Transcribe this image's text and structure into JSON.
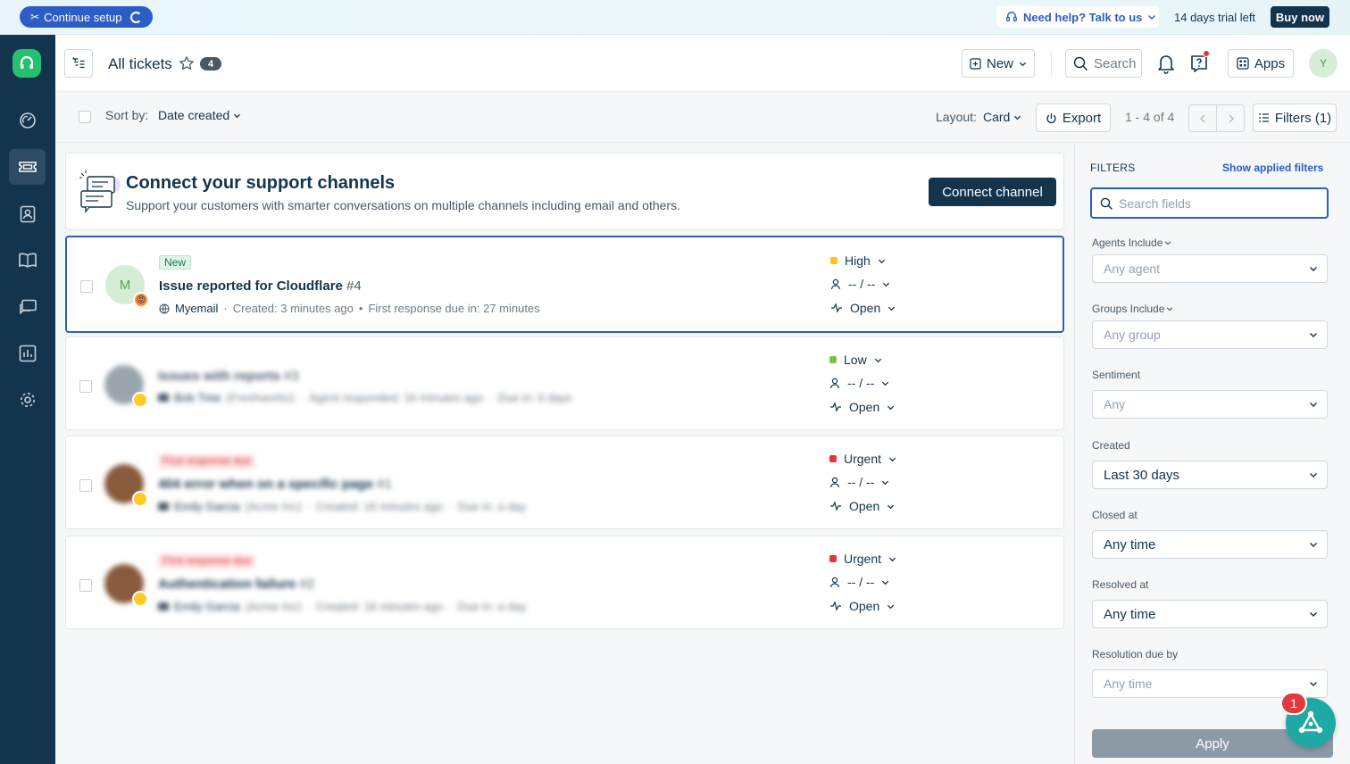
{
  "banner": {
    "continue_setup": "Continue setup",
    "help": "Need help? Talk to us",
    "trial": "14 days trial left",
    "buy_now": "Buy now"
  },
  "header": {
    "title": "All tickets",
    "count": "4",
    "new_label": "New",
    "search_placeholder": "Search",
    "apps_label": "Apps",
    "avatar_initial": "Y"
  },
  "toolbar": {
    "sort_by_label": "Sort by:",
    "sort_value": "Date created",
    "layout_label": "Layout:",
    "layout_value": "Card",
    "export_label": "Export",
    "pagination": "1 - 4 of 4",
    "filters_label": "Filters (1)"
  },
  "channel_card": {
    "title": "Connect your support channels",
    "subtitle": "Support your customers with smarter conversations on multiple channels including email and others.",
    "button": "Connect channel"
  },
  "tickets": [
    {
      "tag": "New",
      "title": "Issue reported for Cloudflare",
      "id": "#4",
      "avatar_initial": "M",
      "requester": "Myemail",
      "meta1": "Created: 3 minutes ago",
      "meta2": "First response due in: 27 minutes",
      "priority": "High",
      "priority_color": "#ffc20e",
      "assignee": "-- / --",
      "status": "Open"
    },
    {
      "tag": "",
      "title": "Issues with reports",
      "id": "#3",
      "requester": "Bob Tree",
      "company": "(Freshworks)",
      "meta1": "Agent responded: 16 minutes ago",
      "meta2": "Due in: 6 days",
      "priority": "Low",
      "priority_color": "#7cc144",
      "assignee": "-- / --",
      "status": "Open"
    },
    {
      "tag": "First response due",
      "title": "404 error when on a specific page",
      "id": "#1",
      "requester": "Emily Garcia",
      "company": "(Acme Inc)",
      "meta1": "Created: 16 minutes ago",
      "meta2": "Due in: a day",
      "priority": "Urgent",
      "priority_color": "#e43538",
      "assignee": "-- / --",
      "status": "Open"
    },
    {
      "tag": "First response due",
      "title": "Authentication failure",
      "id": "#2",
      "requester": "Emily Garcia",
      "company": "(Acme Inc)",
      "meta1": "Created: 16 minutes ago",
      "meta2": "Due in: a day",
      "priority": "Urgent",
      "priority_color": "#e43538",
      "assignee": "-- / --",
      "status": "Open"
    }
  ],
  "filters": {
    "heading": "FILTERS",
    "show_applied": "Show applied filters",
    "search_placeholder": "Search fields",
    "agents_label": "Agents Include",
    "agents_value": "Any agent",
    "groups_label": "Groups Include",
    "groups_value": "Any group",
    "sentiment_label": "Sentiment",
    "sentiment_value": "Any",
    "created_label": "Created",
    "created_value": "Last 30 days",
    "closed_label": "Closed at",
    "closed_value": "Any time",
    "resolved_label": "Resolved at",
    "resolved_value": "Any time",
    "resolution_due_label": "Resolution due by",
    "resolution_due_value": "Any time",
    "apply": "Apply"
  },
  "fab": {
    "badge": "1"
  },
  "colors": {
    "sidebar": "#12344d",
    "accent": "#2c5cc5",
    "brand_green": "#25c16f"
  }
}
